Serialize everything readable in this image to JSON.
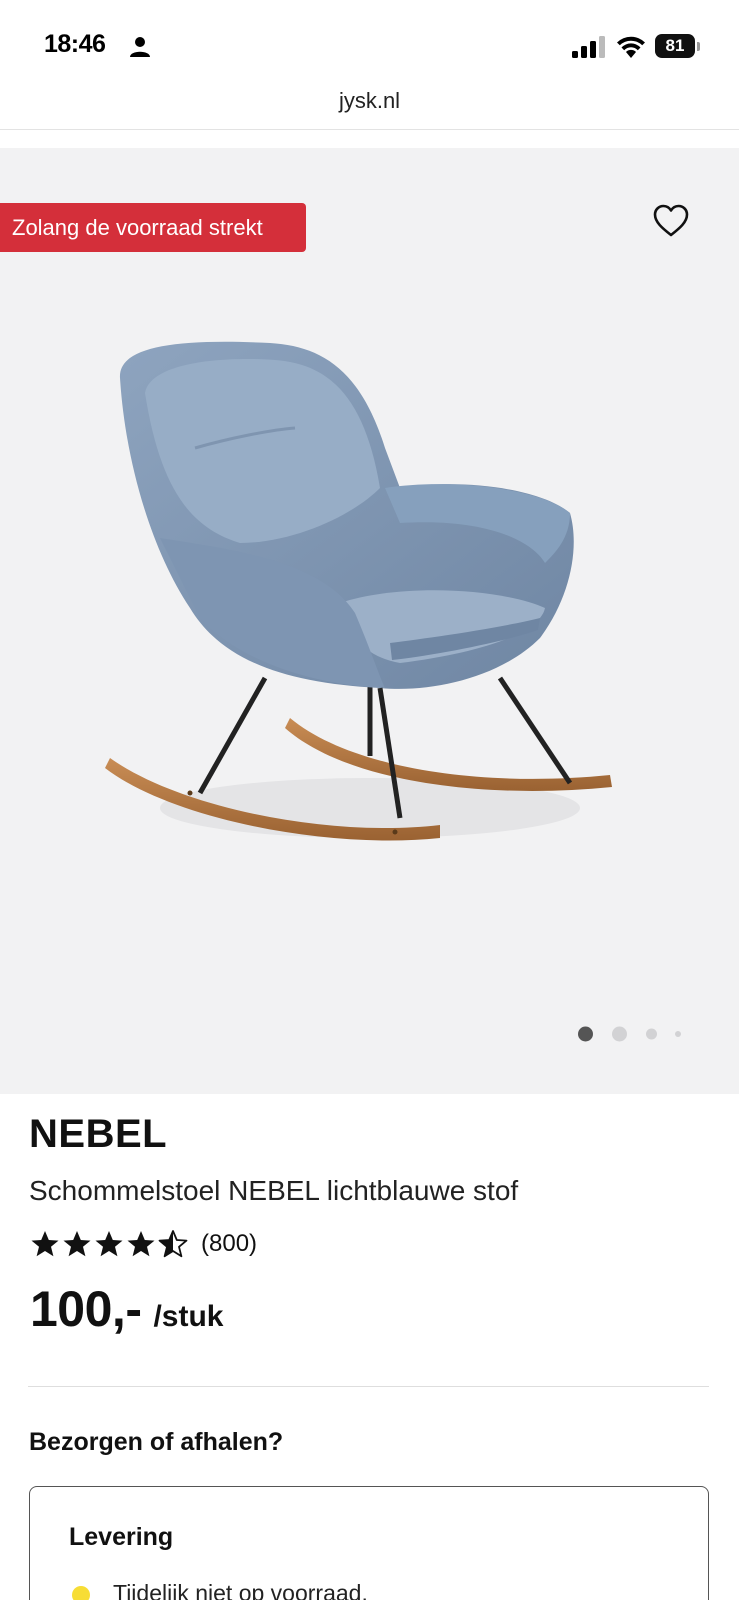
{
  "status_bar": {
    "time": "18:46",
    "battery": "81"
  },
  "browser": {
    "url": "jysk.nl"
  },
  "product_image": {
    "badge": "Zolang de voorraad strekt",
    "carousel_count": 4,
    "carousel_active_index": 0
  },
  "product": {
    "brand": "NEBEL",
    "name": "Schommelstoel NEBEL lichtblauwe stof",
    "rating": 4.5,
    "rating_max": 5,
    "review_count": "(800)",
    "price": "100,-",
    "price_unit": "/stuk"
  },
  "delivery": {
    "heading": "Bezorgen of afhalen?",
    "card_title": "Levering",
    "stock_status": "Tijdelijk niet op voorraad."
  },
  "colors": {
    "badge_red": "#d42f3a",
    "stock_yellow": "#f7dd35",
    "hero_bg": "#f2f2f3"
  }
}
